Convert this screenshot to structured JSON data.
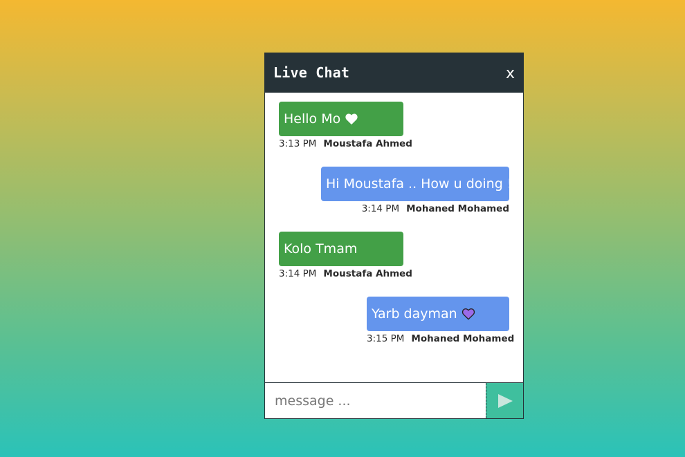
{
  "chat": {
    "title": "Live Chat",
    "close_label": "x"
  },
  "messages": [
    {
      "text": "Hello Mo",
      "icon": "white-heart-icon",
      "time": "3:13 PM",
      "sender": "Moustafa Ahmed",
      "side": "left"
    },
    {
      "text": "Hi Moustafa .. How u doing !",
      "time": "3:14 PM",
      "sender": "Mohaned Mohamed",
      "side": "right"
    },
    {
      "text": "Kolo Tmam",
      "time": "3:14 PM",
      "sender": "Moustafa Ahmed",
      "side": "left"
    },
    {
      "text": "Yarb dayman",
      "icon": "purple-heart-icon",
      "time": "3:15 PM",
      "sender": "Mohaned Mohamed",
      "side": "right"
    }
  ],
  "input": {
    "placeholder": "message ...",
    "value": ""
  },
  "send": {
    "icon": "play-arrow-icon"
  },
  "colors": {
    "header": "#263238",
    "left_bubble": "#43a047",
    "right_bubble": "#6495ed",
    "send_button": "#3fbf9e",
    "purple_heart": "#9b6be8"
  }
}
